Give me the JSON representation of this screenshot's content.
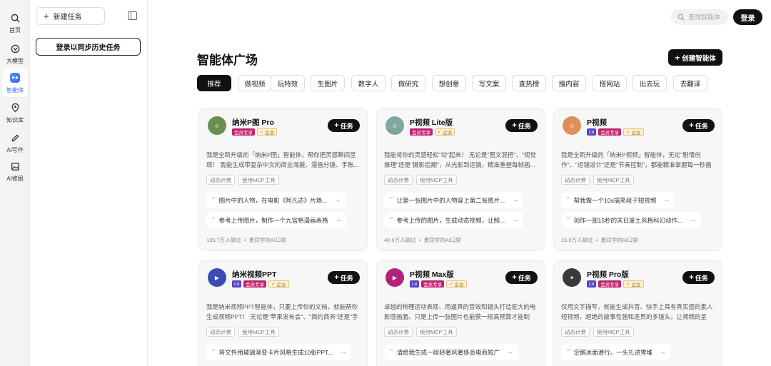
{
  "rail": {
    "items": [
      {
        "label": "首页",
        "icon": "search-icon"
      },
      {
        "label": "大模型",
        "icon": "model-icon"
      },
      {
        "label": "智能体",
        "icon": "agent-icon",
        "active": true
      },
      {
        "label": "知识库",
        "icon": "knowledge-icon"
      },
      {
        "label": "AI写作",
        "icon": "pen-icon"
      },
      {
        "label": "AI修图",
        "icon": "image-icon"
      }
    ]
  },
  "panel": {
    "new_task_label": "新建任务",
    "sync_label": "登录以同步历史任务"
  },
  "header": {
    "search_placeholder": "查找智能体",
    "login_label": "登录"
  },
  "main": {
    "title": "智能体广场",
    "create_label": "创建智能体",
    "tabs": [
      "推荐",
      "做视频",
      "玩特效",
      "生图片",
      "数字人",
      "做研究",
      "想创意",
      "写文案",
      "查热榜",
      "搜内容",
      "搭网站",
      "出去玩",
      "去翻译"
    ],
    "active_tab": "推荐"
  },
  "badge_labels": {
    "l4": "L4",
    "vip": "会员专享",
    "ent": "企业"
  },
  "task_label": "任务",
  "cards": [
    {
      "name": "纳米P图 Pro",
      "avatar_color": "#6b8f4e",
      "badges": [
        "vip",
        "ent"
      ],
      "desc": "我是全新升级的「纳米P图」智能体，帮你把灵感瞬间呈现！ 我能生成带复杂中文的商业海报、漫画分镜、手账...",
      "tags": [
        "动态计费",
        "使用MCP工具"
      ],
      "prompts": [
        "图片中的人物，在电影《阿凡达》片场...",
        "参考上传图片，制作一个九宫格漫画表格"
      ],
      "footer_count": "136.7万人聊过",
      "footer_author": "麦同学的AI口袋"
    },
    {
      "name": "P视频 Lite版",
      "avatar_color": "#7fa6a0",
      "badges": [
        "vip",
        "ent"
      ],
      "desc": "我能将你的灵感轻松\"动\"起来！ 无论是\"图文混搭\"、\"视觉推理\"还是\"摄影后期\"，从光影到运镜，精准重塑每帧画...",
      "tags": [
        "动态计费",
        "使用MCP工具"
      ],
      "prompts": [
        "让第一张图片中的人物穿上第二张图片...",
        "参考上传的图片，生成动态视频，让照..."
      ],
      "footer_count": "40.6万人聊过",
      "footer_author": "麦同学的AI口袋"
    },
    {
      "name": "P视频",
      "avatar_color": "#e08f5a",
      "badges": [
        "l4",
        "vip",
        "ent"
      ],
      "desc": "我是全新升级的「纳米P视频」智能体，无论\"剧情创作\"、\"运镜设计\"还是\"节奏控制\"，都能精准掌握每一秒画面，...",
      "tags": [
        "动态计费",
        "使用MCP工具"
      ],
      "prompts": [
        "帮我做一个10s搞笑段子短视频",
        "创作一部15秒的末日废土风格科幻动作..."
      ],
      "footer_count": "15.9万人聊过",
      "footer_author": "麦同学的AI口袋"
    },
    {
      "name": "纳米视频PPT",
      "avatar_color": "#3b4bb5",
      "badges": [
        "l4",
        "vip",
        "ent"
      ],
      "desc": "我是纳米视频PPT智能体，只要上传你的文档，就能帮你生成视频PPT！ 无论是\"苹果发布会\"、\"简约商务\"还是\"手绘...",
      "tags": [
        "动态计费",
        "使用MCP工具"
      ],
      "prompts": [
        "将文件用玻璃渐变卡片风格生成10张PPT..."
      ],
      "footer_count": "",
      "footer_author": ""
    },
    {
      "name": "P视频 Max版",
      "avatar_color": "#b1237a",
      "badges": [
        "l4",
        "vip",
        "ent"
      ],
      "desc": "卓越的物理运动表现、用逼真的音效和镜头打造宏大的电影感画面。只是上传一张图片也能获一段高预算才能制作...",
      "tags": [
        "动态计费",
        "使用MCP工具"
      ],
      "prompts": [
        "请给我生成一段轻奢风奢侈品电商短广"
      ],
      "footer_count": "",
      "footer_author": ""
    },
    {
      "name": "P视频 Pro版",
      "avatar_color": "#3a3a3a",
      "badges": [
        "l4",
        "vip",
        "ent"
      ],
      "desc": "仅用文字描写，就能生成抖音、快手上具有真实感的素人短视频，超绝的故事性强和连贯的多镜头，让视频的呈现...",
      "tags": [
        "动态计费",
        "使用MCP工具"
      ],
      "prompts": [
        "企鹅冰面滑行。一头扎进雪堆"
      ],
      "footer_count": "",
      "footer_author": ""
    }
  ]
}
